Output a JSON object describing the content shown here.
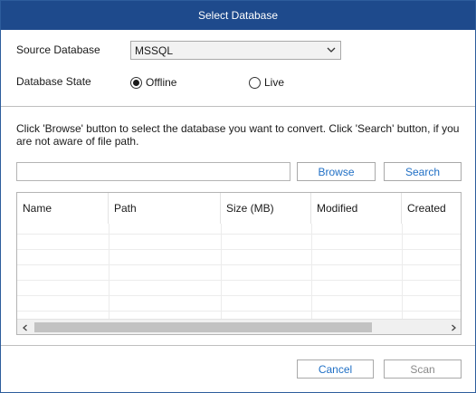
{
  "window": {
    "title": "Select Database"
  },
  "form": {
    "source_label": "Source Database",
    "source_value": "MSSQL",
    "state_label": "Database State",
    "state_options": [
      {
        "label": "Offline",
        "selected": true
      },
      {
        "label": "Live",
        "selected": false
      }
    ]
  },
  "info_text": "Click 'Browse' button to select the database you want to convert. Click 'Search' button, if you are not aware of file path.",
  "path_input": {
    "value": ""
  },
  "buttons": {
    "browse": "Browse",
    "search": "Search",
    "cancel": "Cancel",
    "scan": "Scan"
  },
  "table": {
    "columns": [
      "Name",
      "Path",
      "Size (MB)",
      "Modified",
      "Created"
    ],
    "rows": []
  },
  "colors": {
    "title_bar": "#1e4a8c",
    "link_text": "#1f6fc5",
    "disabled_text": "#8a8a8a"
  },
  "icons": {
    "dropdown": "chevron-down-icon",
    "scroll_left": "chevron-left-icon",
    "scroll_right": "chevron-right-icon"
  }
}
